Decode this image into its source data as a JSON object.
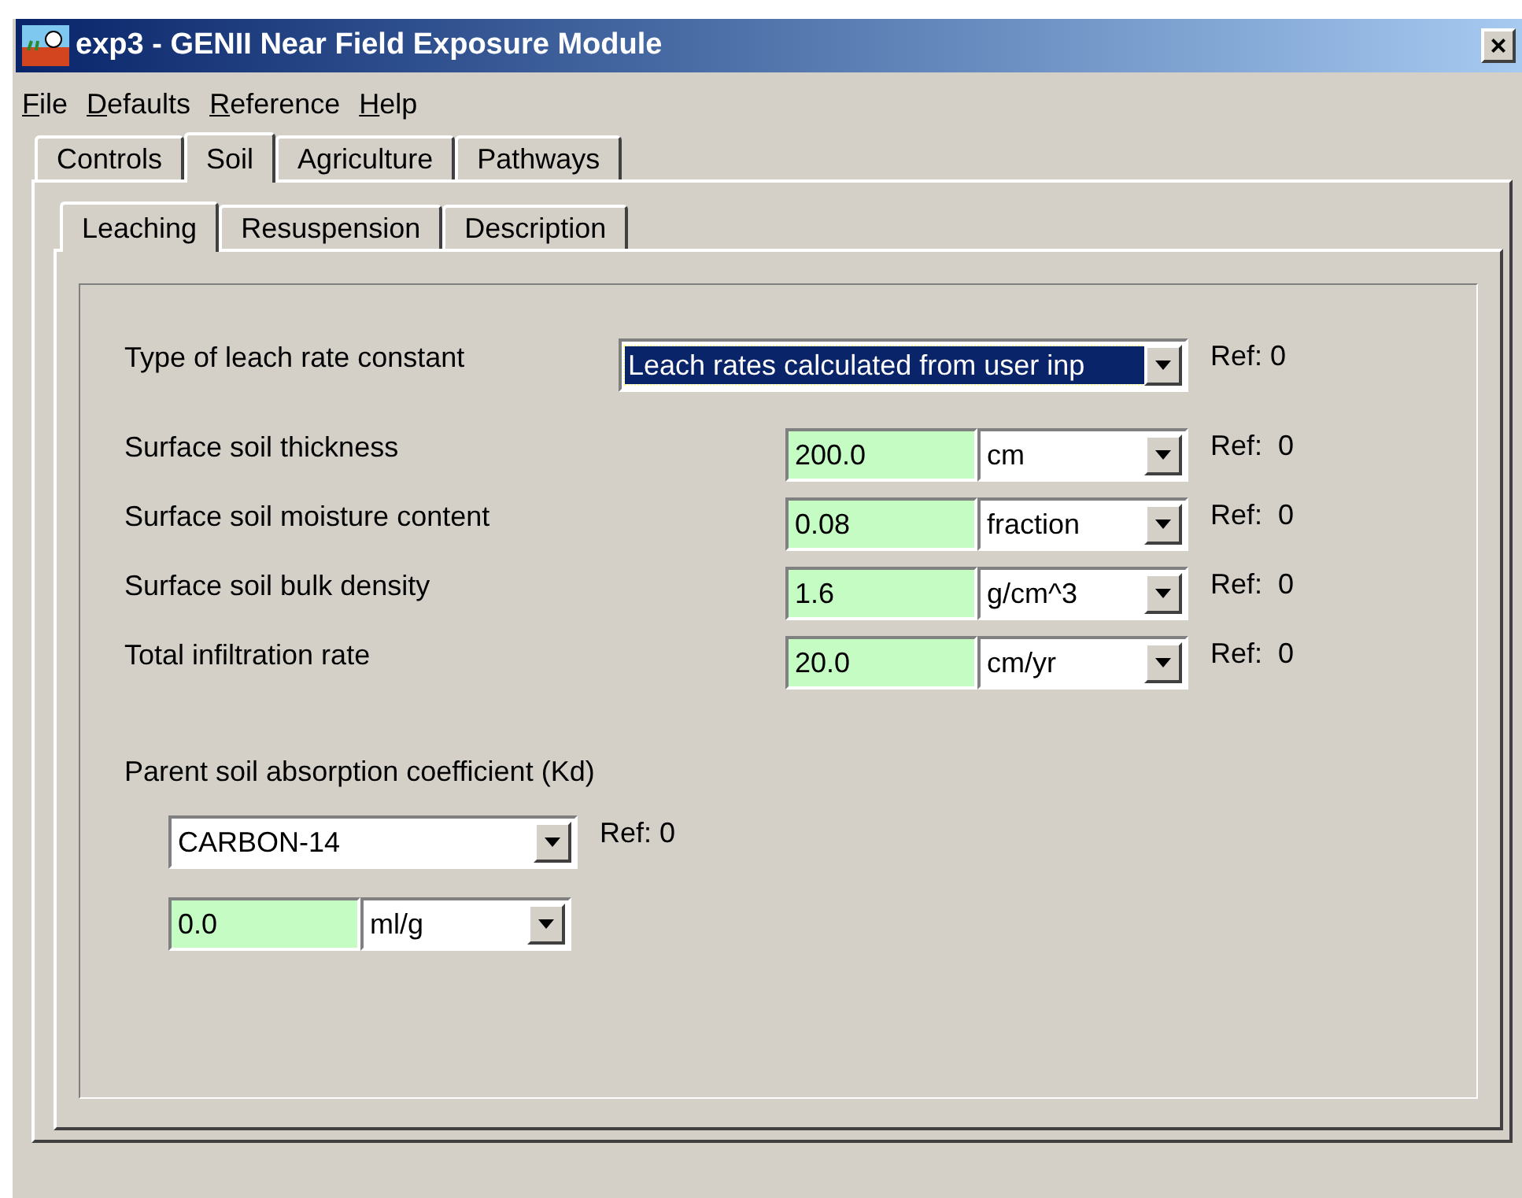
{
  "window": {
    "title": "exp3 - GENII Near Field Exposure Module",
    "close": "×"
  },
  "menu": [
    "File",
    "Defaults",
    "Reference",
    "Help"
  ],
  "tabs": [
    {
      "label": "Controls",
      "selected": false
    },
    {
      "label": "Soil",
      "selected": true
    },
    {
      "label": "Agriculture",
      "selected": false
    },
    {
      "label": "Pathways",
      "selected": false
    }
  ],
  "subtabs": [
    {
      "label": "Leaching",
      "selected": true
    },
    {
      "label": "Resuspension",
      "selected": false
    },
    {
      "label": "Description",
      "selected": false
    }
  ],
  "leach_type": {
    "label": "Type of leach rate constant",
    "value": "Leach rates calculated from user inp",
    "focused": true,
    "ref": "Ref: 0"
  },
  "rows": [
    {
      "label": "Surface soil thickness",
      "value": "200.0",
      "unit": "cm",
      "ref": "Ref:  0"
    },
    {
      "label": "Surface soil moisture content",
      "value": "0.08",
      "unit": "fraction",
      "ref": "Ref:  0"
    },
    {
      "label": "Surface soil bulk density",
      "value": "1.6",
      "unit": "g/cm^3",
      "ref": "Ref:  0"
    },
    {
      "label": "Total infiltration rate",
      "value": "20.0",
      "unit": "cm/yr",
      "ref": "Ref:  0"
    }
  ],
  "kd": {
    "label": "Parent soil absorption coefficient (Kd)",
    "nuclide": "CARBON-14",
    "ref": "Ref: 0",
    "value": "0.0",
    "unit": "ml/g"
  }
}
